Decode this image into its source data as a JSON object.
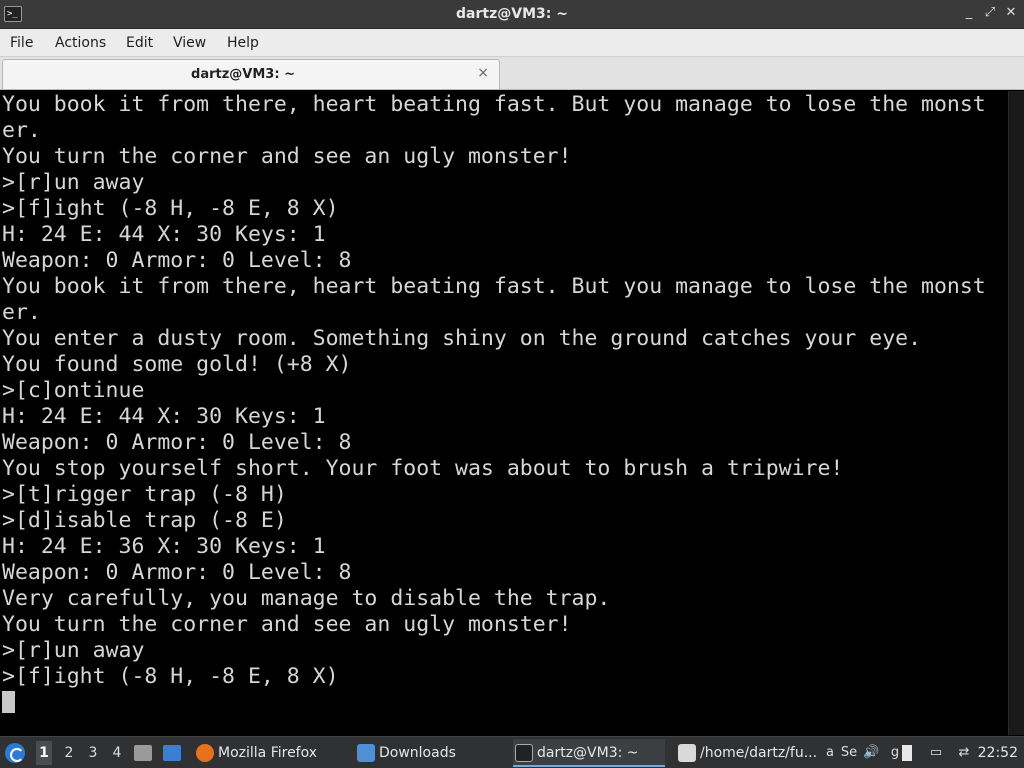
{
  "window": {
    "title": "dartz@VM3: ~",
    "icon": "terminal-icon",
    "controls": [
      "minimize-icon",
      "maximize-icon",
      "close-icon"
    ]
  },
  "menu": {
    "file": "File",
    "actions": "Actions",
    "edit": "Edit",
    "view": "View",
    "help": "Help"
  },
  "tab": {
    "label": "dartz@VM3: ~",
    "close": "×"
  },
  "terminal": {
    "lines": [
      "You book it from there, heart beating fast. But you manage to lose the monst",
      "er.",
      "You turn the corner and see an ugly monster!",
      ">[r]un away",
      ">[f]ight (-8 H, -8 E, 8 X)",
      "H: 24 E: 44 X: 30 Keys: 1",
      "Weapon: 0 Armor: 0 Level: 8",
      "You book it from there, heart beating fast. But you manage to lose the monst",
      "er.",
      "You enter a dusty room. Something shiny on the ground catches your eye.",
      "You found some gold! (+8 X)",
      ">[c]ontinue",
      "H: 24 E: 44 X: 30 Keys: 1",
      "Weapon: 0 Armor: 0 Level: 8",
      "You stop yourself short. Your foot was about to brush a tripwire!",
      ">[t]rigger trap (-8 H)",
      ">[d]isable trap (-8 E)",
      "H: 24 E: 36 X: 30 Keys: 1",
      "Weapon: 0 Armor: 0 Level: 8",
      "Very carefully, you manage to disable the trap.",
      "You turn the corner and see an ugly monster!",
      ">[r]un away",
      ">[f]ight (-8 H, -8 E, 8 X)"
    ]
  },
  "taskbar": {
    "workspaces": [
      "1",
      "2",
      "3",
      "4"
    ],
    "active_workspace": "1",
    "tasks": {
      "firefox": "Mozilla Firefox",
      "downloads": "Downloads",
      "terminal": "dartz@VM3: ~",
      "editor": "/home/dartz/fu..."
    },
    "tray_text": {
      "se": "Se",
      "g": "g",
      "a": "a"
    },
    "clock": "22:52"
  },
  "colors": {
    "terminal_bg": "#000000",
    "terminal_fg": "#d6d6d6",
    "titlebar_bg": "#3a3a3a",
    "taskbar_bg": "#2f3133",
    "accent": "#2b7bd6"
  }
}
